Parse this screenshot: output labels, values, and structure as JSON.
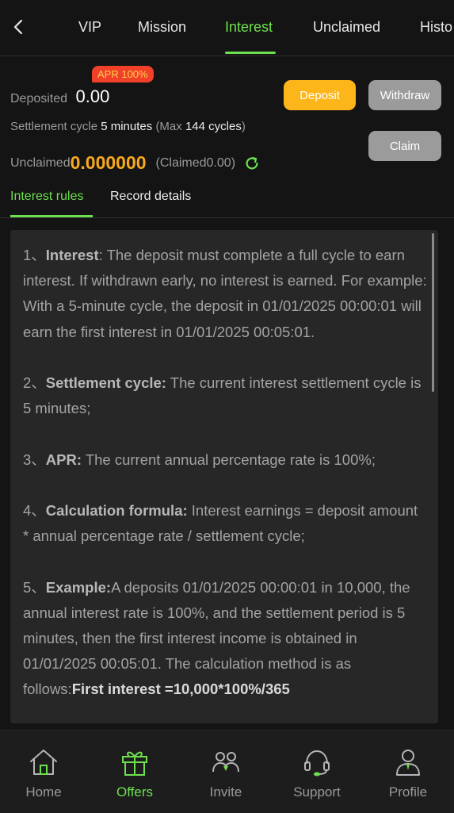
{
  "nav": {
    "tabs": [
      {
        "label": "VIP"
      },
      {
        "label": "Mission"
      },
      {
        "label": "Interest"
      },
      {
        "label": "Unclaimed"
      },
      {
        "label": "Histo"
      }
    ],
    "active_tab": "Interest"
  },
  "summary": {
    "apr_badge": "APR 100%",
    "deposited_label": "Deposited",
    "deposited_value": "0.00",
    "deposit_button": "Deposit",
    "withdraw_button": "Withdraw",
    "claim_button": "Claim",
    "settlement_label": "Settlement cycle",
    "settlement_value": "5 minutes",
    "settlement_max_prefix": "(Max",
    "settlement_max_value": "144 cycles",
    "settlement_max_suffix": ")",
    "unclaimed_label": "Unclaimed",
    "unclaimed_value": "0.000000",
    "claimed_text": "(Claimed0.00)"
  },
  "subtabs": {
    "rules": "Interest rules",
    "records": "Record details"
  },
  "rules": [
    {
      "number": "1、",
      "title": "Interest",
      "body": ": The deposit must complete a full cycle to earn interest. If withdrawn early, no interest is earned. For example: With a 5-minute cycle, the deposit in 01/01/2025 00:00:01 will earn the first interest in 01/01/2025 00:05:01."
    },
    {
      "number": "2、",
      "title": "Settlement cycle:",
      "body": " The current interest settlement cycle is 5 minutes;"
    },
    {
      "number": "3、",
      "title": "APR:",
      "body": " The current annual percentage rate is 100%;"
    },
    {
      "number": "4、",
      "title": "Calculation formula:",
      "body": " Interest earnings = deposit amount * annual percentage rate / settlement cycle;"
    },
    {
      "number": "5、",
      "title": "Example:",
      "body": "A deposits 01/01/2025 00:00:01 in 10,000, the annual interest rate is 100%, and the settlement period is 5 minutes, then the first interest income is obtained in 01/01/2025 00:05:01. The calculation method is as follows:",
      "highlight": "First interest =10,000*100%/365"
    }
  ],
  "bottom_nav": [
    {
      "label": "Home",
      "icon": "home-icon"
    },
    {
      "label": "Offers",
      "icon": "gift-icon"
    },
    {
      "label": "Invite",
      "icon": "invite-icon"
    },
    {
      "label": "Support",
      "icon": "headset-icon"
    },
    {
      "label": "Profile",
      "icon": "profile-icon"
    }
  ],
  "colors": {
    "accent": "#6ee04f",
    "deposit": "#fdb619",
    "amount": "#f8a91d",
    "badge": "#f0402a"
  }
}
